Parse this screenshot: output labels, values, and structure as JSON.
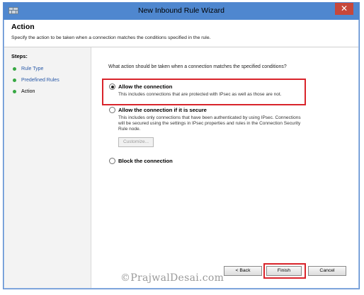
{
  "window": {
    "title": "New Inbound Rule Wizard",
    "close_label": "✕"
  },
  "header": {
    "title": "Action",
    "description": "Specify the action to be taken when a connection matches the conditions specified in the rule."
  },
  "steps": {
    "label": "Steps:",
    "items": [
      {
        "label": "Rule Type",
        "current": false
      },
      {
        "label": "Predefined Rules",
        "current": false
      },
      {
        "label": "Action",
        "current": true
      }
    ]
  },
  "main": {
    "question": "What action should be taken when a connection matches the specified conditions?",
    "options": [
      {
        "label": "Allow the connection",
        "desc": "This includes connections that are protected with IPsec as well as those are not.",
        "selected": true
      },
      {
        "label": "Allow the connection if it is secure",
        "desc1": "This includes only connections that have been authenticated by using IPsec.  Connections",
        "desc2": "will be secured using the settings in IPsec properties and rules in the Connection Security",
        "desc3": "Rule node.",
        "selected": false
      },
      {
        "label": "Block the connection",
        "selected": false
      }
    ],
    "customize_label": "Customize..."
  },
  "buttons": {
    "back": "< Back",
    "finish": "Finish",
    "cancel": "Cancel"
  },
  "watermark": "©PrajwalDesai.com",
  "colors": {
    "titlebar": "#4f87cf",
    "close": "#c7473a",
    "highlight": "#d9242b",
    "step_dot": "#37a843",
    "link": "#2a5aa8"
  }
}
